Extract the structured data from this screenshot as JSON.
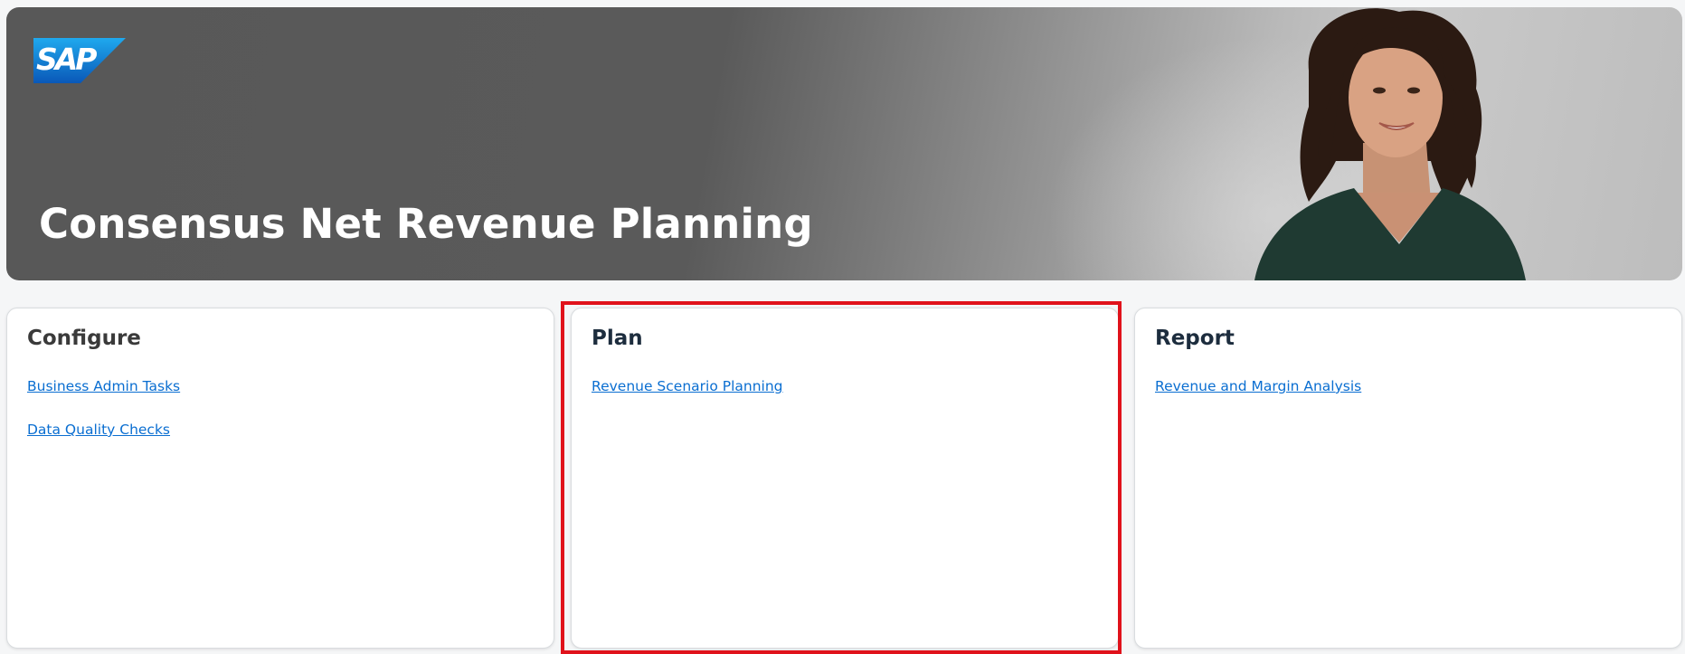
{
  "hero": {
    "logo_text": "SAP",
    "title": "Consensus Net Revenue Planning"
  },
  "cards": [
    {
      "title": "Configure",
      "links": [
        "Business Admin Tasks",
        "Data Quality Checks"
      ]
    },
    {
      "title": "Plan",
      "links": [
        "Revenue Scenario Planning"
      ]
    },
    {
      "title": "Report",
      "links": [
        "Revenue and Margin Analysis"
      ]
    }
  ],
  "colors": {
    "link": "#0a6ed1",
    "highlight": "#e0121b",
    "logo_blue": "#0f75cf",
    "heading": "#1d2d3e"
  }
}
